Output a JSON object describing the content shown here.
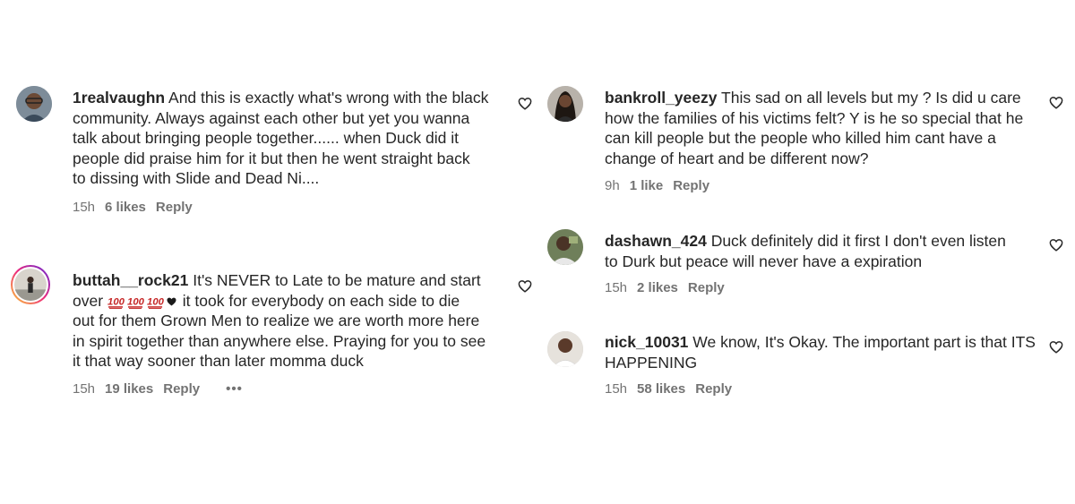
{
  "comments": [
    {
      "username": "1realvaughn",
      "lines": [
        "And this is exactly what's wrong with the black",
        "community. Always against each other but yet you wanna",
        "talk about bringing people together...... when Duck did it",
        "people did praise him for it but then he went straight back",
        "to dissing with Slide and Dead Ni...."
      ],
      "time": "15h",
      "likes": "6 likes",
      "reply": "Reply"
    },
    {
      "username": "buttah__rock21",
      "line1": "It's NEVER to Late to be mature and start",
      "line2_prefix": "over",
      "emoji_name": "hundred-points",
      "line2_suffix": "it took for everybody on each side to die",
      "lines": [
        "out for them Grown Men to realize we are worth more here",
        "in spirit together than anywhere else. Praying for you to see",
        "it that way sooner than later momma duck"
      ],
      "time": "15h",
      "likes": "19 likes",
      "reply": "Reply",
      "more": "•••"
    },
    {
      "username": "bankroll_yeezy",
      "lines": [
        "This sad on all levels but my ? Is did u care",
        "how the families of his victims felt? Y is he so special that he",
        "can kill people but the people who killed him cant have a",
        "change of heart and be different now?"
      ],
      "time": "9h",
      "likes": "1 like",
      "reply": "Reply"
    },
    {
      "username": "dashawn_424",
      "lines": [
        "Duck definitely did it first I don't even listen",
        "to Durk but peace will never have a expiration"
      ],
      "time": "15h",
      "likes": "2 likes",
      "reply": "Reply"
    },
    {
      "username": "nick_10031",
      "lines": [
        "We know, It's Okay. The important part is that ITS",
        "HAPPENING"
      ],
      "time": "15h",
      "likes": "58 likes",
      "reply": "Reply"
    }
  ],
  "colors": {
    "text": "#262626",
    "meta": "#737373",
    "emoji_red": "#c62828"
  }
}
